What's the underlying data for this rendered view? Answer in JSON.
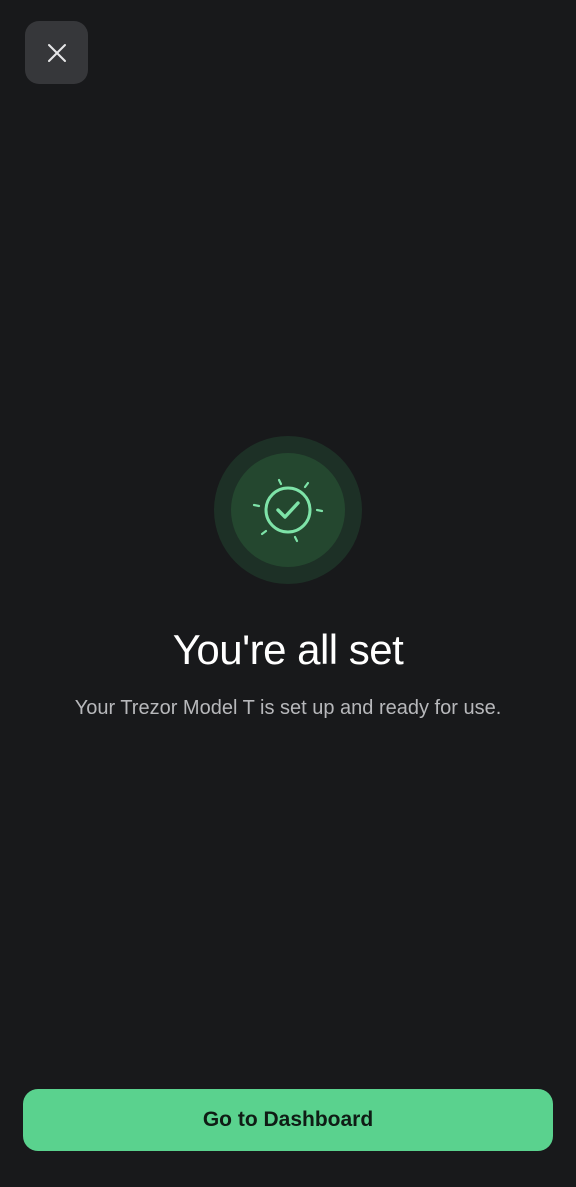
{
  "header": {
    "close_icon": "close-icon"
  },
  "illustration": {
    "icon": "check-circle-sparkle-icon",
    "accent_color": "#5ad28e",
    "outer_color": "#1d3026",
    "inner_color": "#24472f"
  },
  "content": {
    "title": "You're all set",
    "subtitle": "Your Trezor Model T is set up and ready for use."
  },
  "footer": {
    "primary_button_label": "Go to Dashboard",
    "primary_button_color": "#5ad28e"
  },
  "theme": {
    "background": "#18191b"
  }
}
